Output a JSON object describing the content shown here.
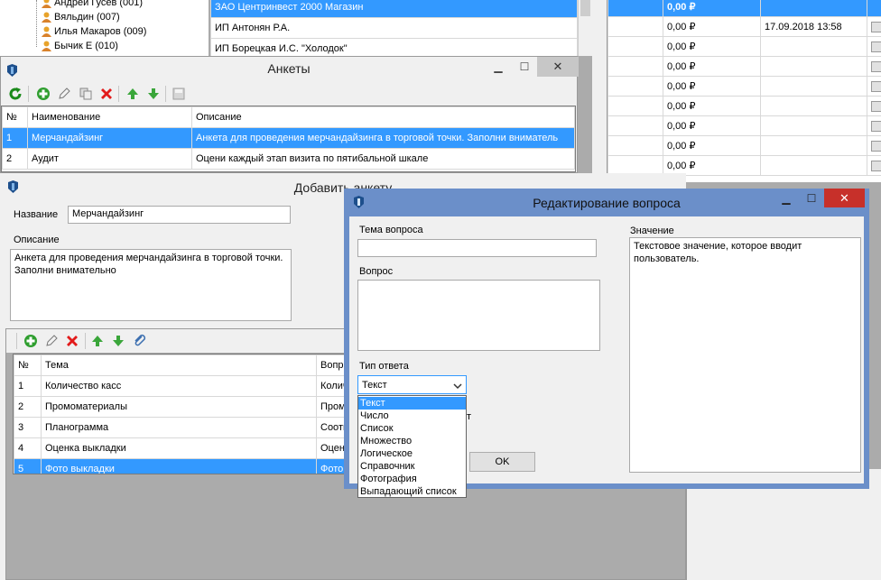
{
  "tree": {
    "items": [
      "Андрей Гусев (001)",
      "Вяльдин (007)",
      "Илья Макаров (009)",
      "Бычик Е (010)"
    ]
  },
  "clients": {
    "rows": [
      "ЗАО Центринвест 2000 Магазин",
      "ИП Антонян Р.А.",
      "ИП Борецкая И.С. \"Холодок\""
    ]
  },
  "right_grid": {
    "rows": [
      {
        "amount": "0,00 ₽",
        "date": ""
      },
      {
        "amount": "0,00 ₽",
        "date": "17.09.2018 13:58"
      },
      {
        "amount": "0,00 ₽",
        "date": ""
      },
      {
        "amount": "0,00 ₽",
        "date": ""
      },
      {
        "amount": "0,00 ₽",
        "date": ""
      },
      {
        "amount": "0,00 ₽",
        "date": ""
      },
      {
        "amount": "0,00 ₽",
        "date": ""
      },
      {
        "amount": "0,00 ₽",
        "date": ""
      },
      {
        "amount": "0,00 ₽",
        "date": ""
      }
    ]
  },
  "surveys": {
    "title": "Анкеты",
    "columns": [
      "№",
      "Наименование",
      "Описание"
    ],
    "rows": [
      {
        "num": "1",
        "name": "Мерчандайзинг",
        "desc": "Анкета для проведения мерчандайзинга в торговой точки. Заполни вниматель"
      },
      {
        "num": "2",
        "name": "Аудит",
        "desc": "Оцени каждый этап визита по пятибальной шкале"
      }
    ]
  },
  "add_survey": {
    "title": "Добавить анкету",
    "name_label": "Название",
    "name_value": "Мерчандайзинг",
    "desc_label": "Описание",
    "desc_value": "Анкета для проведения мерчандайзинга в торговой точки. Заполни внимательно",
    "columns": [
      "№",
      "Тема",
      "Вопр"
    ],
    "rows": [
      {
        "num": "1",
        "topic": "Количество касс",
        "q": "Колич"
      },
      {
        "num": "2",
        "topic": "Промоматериалы",
        "q": "Промо"
      },
      {
        "num": "3",
        "topic": "Планограмма",
        "q": "Соотв"
      },
      {
        "num": "4",
        "topic": "Оценка выкладки",
        "q": "Оцени"
      },
      {
        "num": "5",
        "topic": "Фото выкладки",
        "q": "Фото"
      }
    ]
  },
  "edit_question": {
    "title": "Редактирование вопроса",
    "topic_label": "Тема вопроса",
    "topic_value": "",
    "question_label": "Вопрос",
    "question_value": "",
    "answer_type_label": "Тип ответа",
    "answer_type_value": "Текст",
    "answer_type_options": [
      "Текст",
      "Число",
      "Список",
      "Множество",
      "Логическое",
      "Справочник",
      "Фотография",
      "Выпадающий список"
    ],
    "hidden_fragment": "т",
    "value_label": "Значение",
    "value_text": "Текстовое значение, которое вводит пользователь.",
    "ok_label": "OK"
  },
  "colors": {
    "selection": "#3399ff",
    "dialog_frame": "#6b8fc9",
    "close_red": "#c7302a"
  }
}
